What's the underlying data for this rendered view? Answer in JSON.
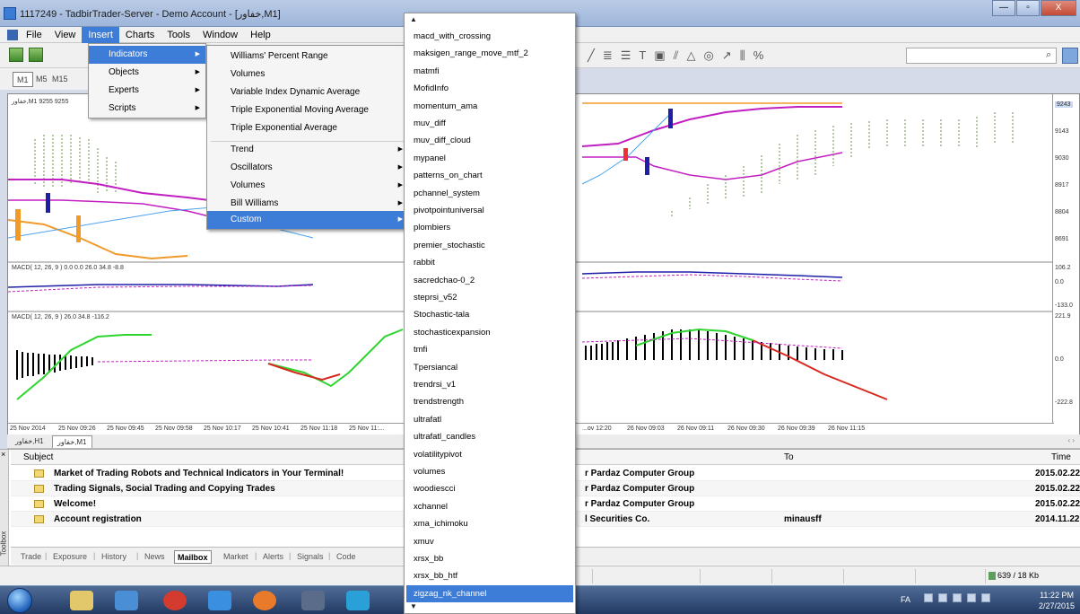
{
  "window": {
    "title": "1117249 - TadbirTrader-Server - Demo Account - [خفاور,M1]",
    "controls": [
      "—",
      "▫",
      "X"
    ]
  },
  "menubar": {
    "items": [
      "File",
      "View",
      "Insert",
      "Charts",
      "Tools",
      "Window",
      "Help"
    ],
    "active": "Insert"
  },
  "periods": [
    "M1",
    "M5",
    "M15"
  ],
  "insert_menu": {
    "items": [
      {
        "label": "Indicators",
        "submenu": true,
        "selected": true
      },
      {
        "label": "Objects",
        "submenu": true
      },
      {
        "label": "Experts",
        "submenu": true
      },
      {
        "label": "Scripts",
        "submenu": true
      }
    ]
  },
  "indicators_menu": {
    "recent": [
      "Williams' Percent Range",
      "Volumes",
      "Variable Index Dynamic Average",
      "Triple Exponential Moving Average",
      "Triple Exponential Average"
    ],
    "groups": [
      {
        "label": "Trend",
        "submenu": true
      },
      {
        "label": "Oscillators",
        "submenu": true
      },
      {
        "label": "Volumes",
        "submenu": true
      },
      {
        "label": "Bill Williams",
        "submenu": true
      },
      {
        "label": "Custom",
        "submenu": true,
        "selected": true
      }
    ]
  },
  "custom_list": {
    "items": [
      "macd_with_crossing",
      "maksigen_range_move_mtf_2",
      "matmfi",
      "MofidInfo",
      "momentum_ama",
      "muv_diff",
      "muv_diff_cloud",
      "mypanel",
      "patterns_on_chart",
      "pchannel_system",
      "pivotpointuniversal",
      "plombiers",
      "premier_stochastic",
      "rabbit",
      "sacredchao-0_2",
      "steprsi_v52",
      "Stochastic-tala",
      "stochasticexpansion",
      "tmfi",
      "Tpersiancal",
      "trendrsi_v1",
      "trendstrength",
      "ultrafatl",
      "ultrafatl_candles",
      "volatilitypivot",
      "volumes",
      "woodiescci",
      "xchannel",
      "xma_ichimoku",
      "xmuv",
      "xrsx_bb",
      "xrsx_bb_htf",
      "zigzag_nk_channel"
    ],
    "selected": "zigzag_nk_channel"
  },
  "chart": {
    "main_label": "خفاور,M1  9255 9255",
    "macd1_label": "MACD( 12, 26, 9 ) 0.0 0.0 26.0 34.8 -8.8",
    "macd2_label": "MACD( 12, 26, 9 ) 26.0 34.8 -116.2",
    "price_labels": [
      "9243",
      "9143",
      "9030",
      "8917",
      "8804",
      "8691"
    ],
    "macd1_labels": [
      "106.2",
      "0.0",
      "-133.0"
    ],
    "macd2_labels": [
      "221.9",
      "0.0",
      "-222.8"
    ],
    "time_labels_left": [
      "25 Nov 2014",
      "25 Nov 09:26",
      "25 Nov 09:45",
      "25 Nov 09:58",
      "25 Nov 10:17",
      "25 Nov 10:41",
      "25 Nov 11:18",
      "25 Nov 11:..."
    ],
    "time_labels_right": [
      "...ov 12:20",
      "26 Nov 09:03",
      "26 Nov 09:11",
      "26 Nov 09:30",
      "26 Nov 09:39",
      "26 Nov 11:15"
    ],
    "tabs": [
      "خفاور,H1",
      "خفاور,M1"
    ],
    "active_tab": "خفاور,M1"
  },
  "mailbox": {
    "columns": {
      "subject": "Subject",
      "to": "To",
      "time": "Time"
    },
    "rows": [
      {
        "subject": "Market of Trading Robots and Technical Indicators in Your Terminal!",
        "from": "r Pardaz Computer Group",
        "to": "",
        "time": "2015.02.22"
      },
      {
        "subject": "Trading Signals, Social Trading and Copying Trades",
        "from": "r Pardaz Computer Group",
        "to": "",
        "time": "2015.02.22"
      },
      {
        "subject": "Welcome!",
        "from": "r Pardaz Computer Group",
        "to": "",
        "time": "2015.02.22"
      },
      {
        "subject": "Account registration",
        "from": "l Securities Co.",
        "to": "minausff",
        "time": "2014.11.22"
      }
    ]
  },
  "terminal_tabs": [
    "Trade",
    "Exposure",
    "History",
    "News",
    "Mailbox",
    "Market",
    "Alerts",
    "Signals",
    "Code"
  ],
  "active_terminal_tab": "Mailbox",
  "toolbox_label": "Toolbox",
  "statusbar": {
    "traffic": "639 / 18 Kb"
  },
  "taskbar": {
    "lang": "FA",
    "time": "11:22 PM",
    "date": "2/27/2015"
  },
  "colors": {
    "accent": "#3d7dd8",
    "green": "#2ed52e",
    "red": "#d62a1e",
    "magenta": "#c21fc2",
    "orange": "#f09a2a",
    "navy": "#1e1ea8"
  }
}
